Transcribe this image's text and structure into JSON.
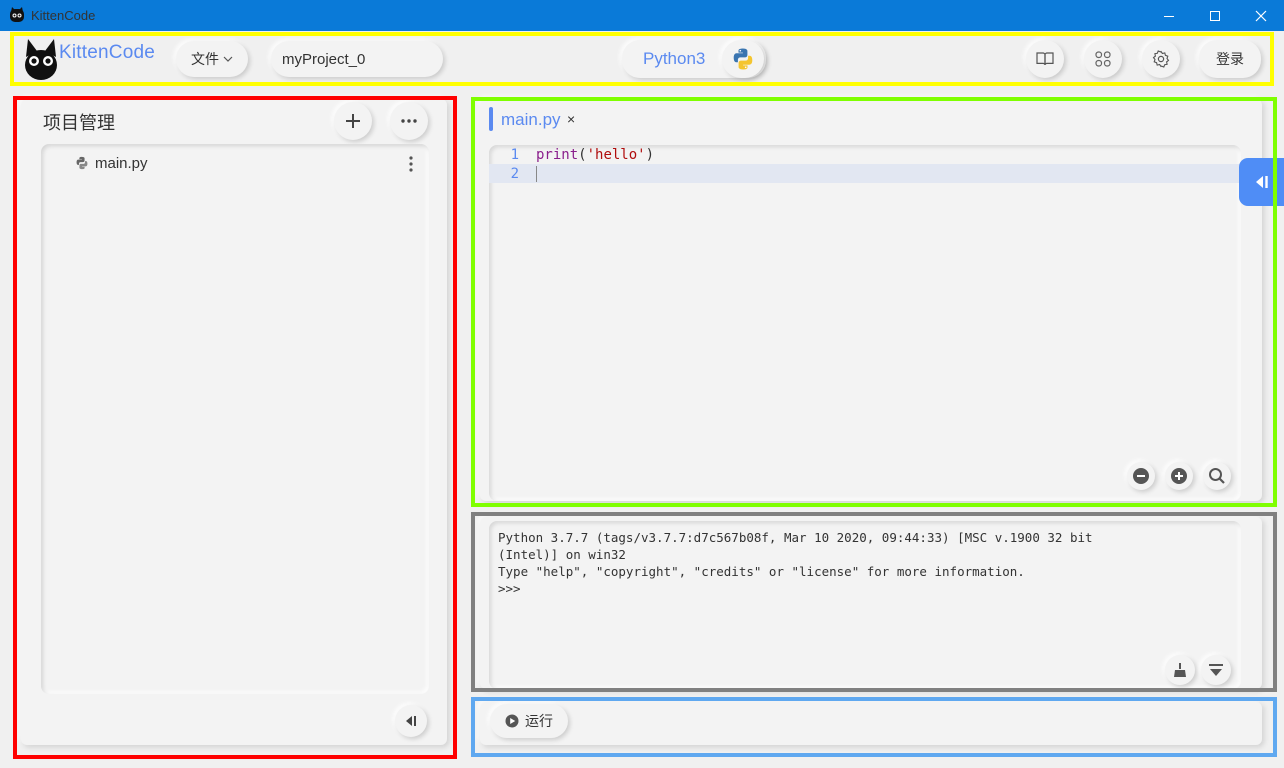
{
  "window": {
    "title": "KittenCode"
  },
  "toolbar": {
    "logo_text": "KittenCode",
    "file_menu_label": "文件",
    "project_name": "myProject_0",
    "language": "Python3",
    "login_label": "登录",
    "icons": [
      "book-icon",
      "apps-icon",
      "gear-icon",
      "python-logo-icon"
    ]
  },
  "project_panel": {
    "title": "项目管理",
    "files": [
      {
        "name": "main.py",
        "icon": "python-file-icon"
      }
    ]
  },
  "editor": {
    "tab_label": "main.py",
    "tab_close": "×",
    "line_numbers": [
      "1",
      "2"
    ],
    "code": {
      "func": "print",
      "open": "(",
      "arg": "'hello'",
      "close": ")"
    }
  },
  "console": {
    "lines": [
      "Python 3.7.7 (tags/v3.7.7:d7c567b08f, Mar 10 2020, 09:44:33) [MSC v.1900 32 bit",
      "(Intel)] on win32",
      "Type \"help\", \"copyright\", \"credits\" or \"license\" for more information.",
      ">>>"
    ]
  },
  "run_bar": {
    "run_label": "运行"
  },
  "colors": {
    "titlebar": "#0a7ad8",
    "accent": "#5b8af0",
    "side_button": "#4f8df6",
    "box_toolbar": "#ffff00",
    "box_left": "#ff0000",
    "box_editor": "#7fff00",
    "box_console": "#808080",
    "box_run": "#5fa8f0"
  }
}
